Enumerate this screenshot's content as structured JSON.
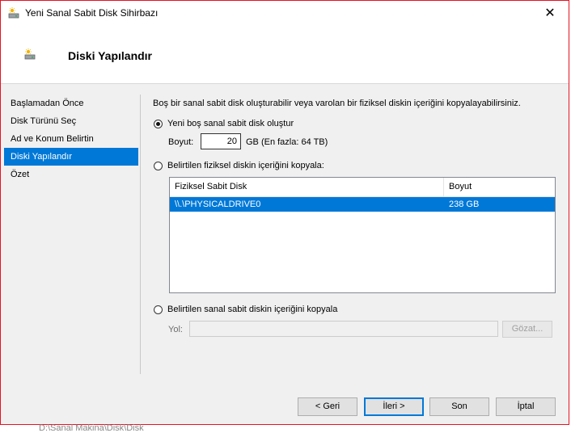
{
  "window": {
    "title": "Yeni Sanal Sabit Disk Sihirbazı",
    "close_glyph": "✕"
  },
  "header": {
    "title": "Diski Yapılandır",
    "icon": "disk-wizard-icon"
  },
  "sidebar": {
    "items": [
      {
        "label": "Başlamadan Önce",
        "active": false
      },
      {
        "label": "Disk Türünü Seç",
        "active": false
      },
      {
        "label": "Ad ve Konum Belirtin",
        "active": false
      },
      {
        "label": "Diski Yapılandır",
        "active": true
      },
      {
        "label": "Özet",
        "active": false
      }
    ]
  },
  "main": {
    "intro": "Boş bir sanal sabit disk oluşturabilir veya varolan bir fiziksel diskin içeriğini kopyalayabilirsiniz.",
    "option_new": {
      "label": "Yeni boş sanal sabit disk oluştur",
      "checked": true,
      "size_label": "Boyut:",
      "size_value": "20",
      "size_unit": "GB (En fazla: 64 TB)"
    },
    "option_physical": {
      "label": "Belirtilen fiziksel diskin içeriğini kopyala:",
      "checked": false,
      "table": {
        "columns": [
          "Fiziksel Sabit Disk",
          "Boyut"
        ],
        "rows": [
          {
            "disk": "\\\\.\\PHYSICALDRIVE0",
            "size": "238 GB",
            "selected": true
          }
        ]
      }
    },
    "option_virtual": {
      "label": "Belirtilen sanal sabit diskin içeriğini kopyala",
      "checked": false,
      "path_label": "Yol:",
      "path_value": "",
      "browse_label": "Gözat..."
    }
  },
  "footer": {
    "back": "< Geri",
    "next": "İleri >",
    "finish": "Son",
    "cancel": "İptal"
  },
  "background_text": "D:\\Sanal Makina\\Disk\\Disk",
  "colors": {
    "accent": "#0078d7",
    "window_border": "#e81123",
    "dialog_bg": "#f0f0f0"
  }
}
